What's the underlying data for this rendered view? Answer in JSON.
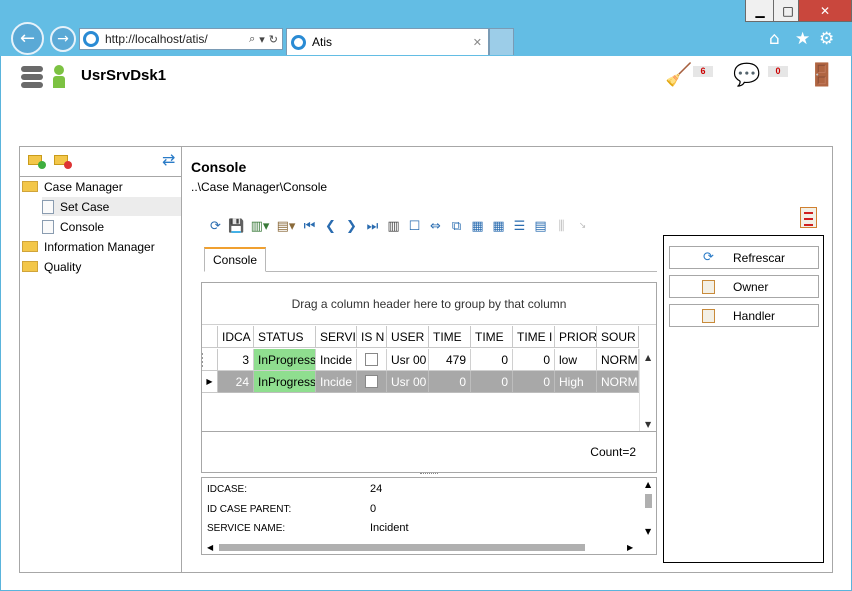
{
  "browser": {
    "address": "http://localhost/atis/",
    "tab_title": "Atis",
    "window_controls": {
      "minimize": "▁",
      "maximize": "□",
      "close": "✕"
    },
    "icons": [
      "back-icon",
      "forward-icon",
      "home-icon",
      "star-icon",
      "gear-icon"
    ]
  },
  "header": {
    "app_name": "UsrSrvDsk1",
    "notifications_count": "6",
    "messages_count": "0"
  },
  "left": {
    "tree": [
      {
        "label": "Case Manager",
        "type": "folder"
      },
      {
        "label": "Set Case",
        "type": "doc"
      },
      {
        "label": "Console",
        "type": "doc"
      },
      {
        "label": "Information Manager",
        "type": "folder"
      },
      {
        "label": "Quality",
        "type": "folder"
      }
    ]
  },
  "main": {
    "title": "Console",
    "breadcrumb": "..\\Case Manager\\Console",
    "tab": "Console",
    "group_hint": "Drag a column header here to group by that column",
    "columns": [
      "IDCA",
      "STATUS",
      "SERVI",
      "IS N",
      "USER",
      "TIME",
      "TIME",
      "TIME I",
      "PRIOR",
      "SOUR"
    ],
    "rows": [
      {
        "id": "3",
        "status": "InProgress",
        "service": "Incide",
        "user": "Usr 00",
        "time1": "479",
        "time2": "0",
        "time3": "0",
        "priority": "low",
        "source": "NORM"
      },
      {
        "id": "24",
        "status": "InProgress",
        "service": "Incide",
        "user": "Usr 00",
        "time1": "0",
        "time2": "0",
        "time3": "0",
        "priority": "High",
        "source": "NORM"
      }
    ],
    "count": "Count=2",
    "detail": [
      {
        "label": "IDCASE:",
        "value": "24"
      },
      {
        "label": "ID CASE PARENT:",
        "value": "0"
      },
      {
        "label": "SERVICE NAME:",
        "value": "Incident"
      }
    ]
  },
  "actions": {
    "refresh": "Refrescar",
    "owner": "Owner",
    "handler": "Handler"
  },
  "colors": {
    "status_green": "#8fde8f",
    "selected_row": "#a8a8a8",
    "chrome_blue": "#63bde4",
    "tab_accent": "#f0a030"
  }
}
